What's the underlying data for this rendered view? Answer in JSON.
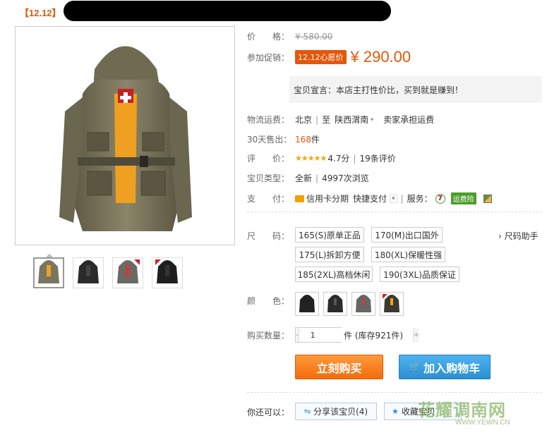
{
  "title": {
    "tag": "【12.12】"
  },
  "price": {
    "label": "价　　格：",
    "original": "¥ 580.00"
  },
  "promo": {
    "label": "参加促销：",
    "badge": "12.12心愿价",
    "price": "¥ 290.00"
  },
  "slogan": "宝贝宣言：本店主打性价比，买到就是赚到！",
  "shipping": {
    "label": "物流运费：",
    "from": "北京",
    "to_word": "至",
    "to": "陕西渭南",
    "fee": "卖家承担运费"
  },
  "sales": {
    "label": "30天售出：",
    "count": "168",
    "unit": "件"
  },
  "rating": {
    "label": "评　　价：",
    "stars": "★★★★★",
    "score": "4.7分",
    "reviews": "19条评价"
  },
  "type": {
    "label": "宝贝类型：",
    "condition": "全新",
    "views": "4997次浏览"
  },
  "payment": {
    "label": "支　　付：",
    "credit": "信用卡分期",
    "quick": "快捷支付",
    "service_label": "服务：",
    "service_7": "7",
    "service_badge": "运费险"
  },
  "size": {
    "label": "尺　　码：",
    "guide": "› 尺码助手",
    "options": [
      "165(S)原单正品",
      "170(M)出口国外",
      "175(L)拆卸方便",
      "180(XL)保暖性强",
      "185(2XL)高档休闲",
      "190(3XL)品质保证"
    ]
  },
  "color": {
    "label": "颜　　色："
  },
  "quantity": {
    "label": "购买数量：",
    "value": "1",
    "minus": "-",
    "plus": "+",
    "stock": "件 (库存921件)"
  },
  "buttons": {
    "buy": "立刻购买",
    "cart": "加入购物车"
  },
  "also": {
    "label": "你还可以：",
    "share": "分享该宝贝(4)",
    "fav": "收藏宝贝"
  },
  "watermark": {
    "main": "花耀调南网",
    "sub": "WWW.YEWN.CN"
  },
  "colors": {
    "accent": "#e4570a",
    "buy": "#f36c0b",
    "cart": "#2b8fd3"
  }
}
